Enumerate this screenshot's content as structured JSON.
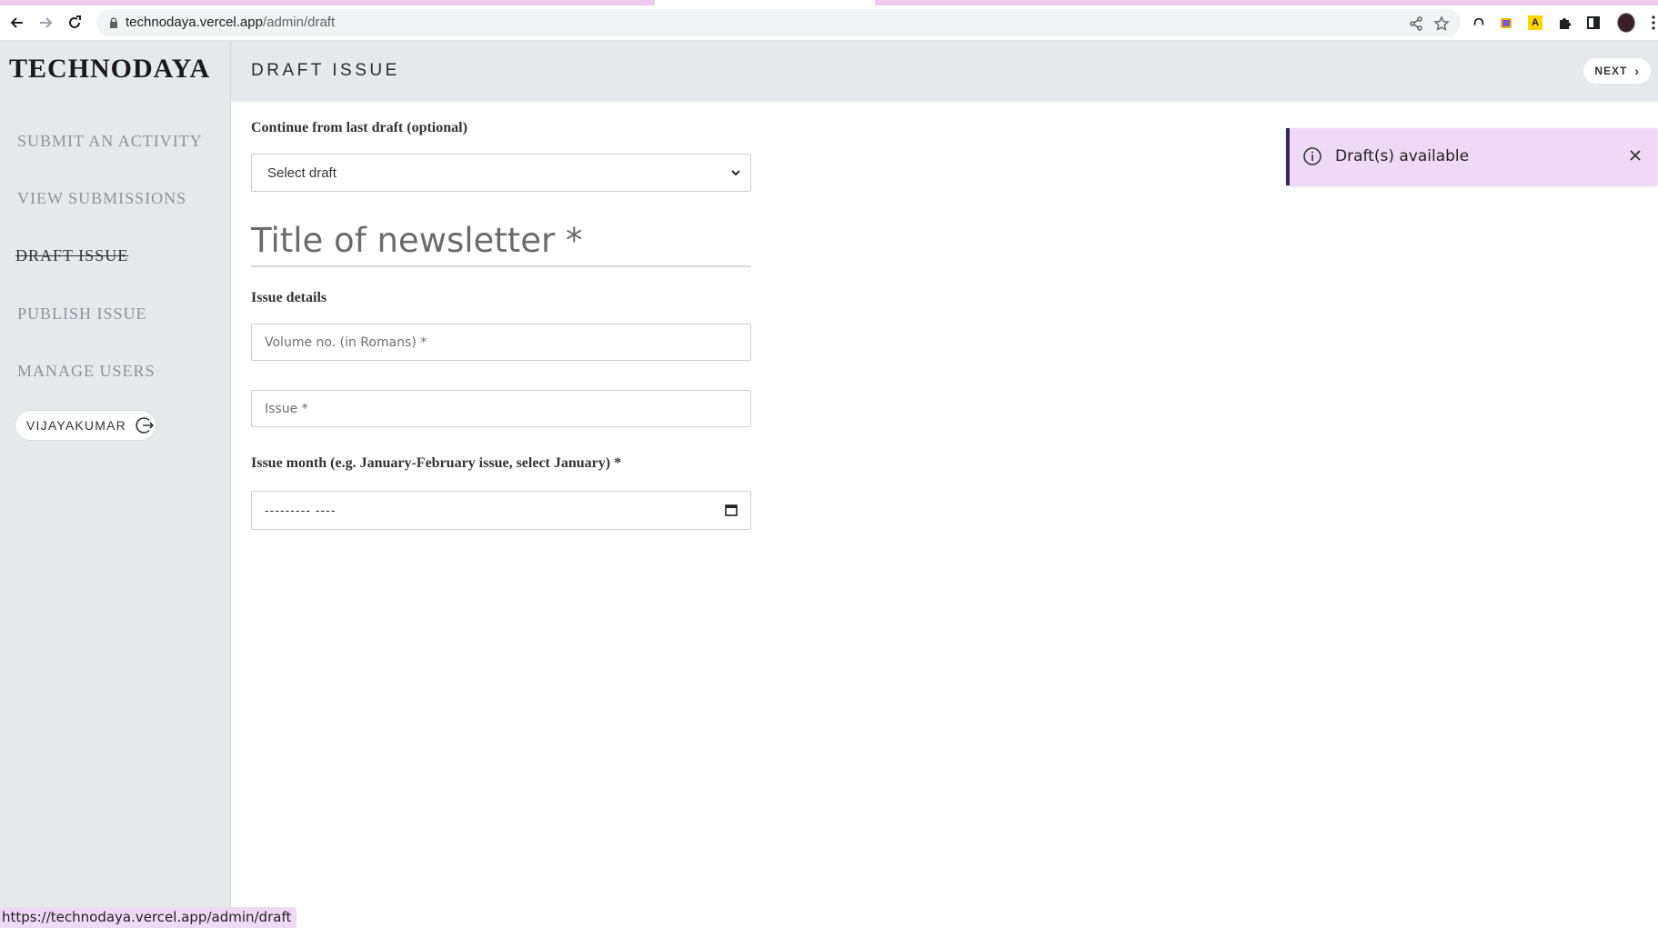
{
  "browser": {
    "url_host": "technodaya.vercel.app",
    "url_path": "/admin/draft",
    "status_url": "https://technodaya.vercel.app/admin/draft",
    "extension_badges": [
      "A"
    ]
  },
  "sidebar": {
    "logo": "TECHNODAYA",
    "items": [
      {
        "label": "SUBMIT AN ACTIVITY",
        "active": false
      },
      {
        "label": "VIEW SUBMISSIONS",
        "active": false
      },
      {
        "label": "DRAFT ISSUE",
        "active": true
      },
      {
        "label": "PUBLISH ISSUE",
        "active": false
      },
      {
        "label": "MANAGE USERS",
        "active": false
      }
    ],
    "user": {
      "name": "VIJAYAKUMAR"
    }
  },
  "header": {
    "title": "DRAFT ISSUE",
    "next_label": "NEXT"
  },
  "form": {
    "draft_label": "Continue from last draft (optional)",
    "draft_select_value": "Select draft",
    "title_placeholder": "Title of newsletter *",
    "issue_details_label": "Issue details",
    "volume_placeholder": "Volume no. (in Romans) *",
    "issue_placeholder": "Issue *",
    "month_label": "Issue month (e.g. January-February issue, select January) *",
    "month_value": "--------- ----"
  },
  "toast": {
    "message": "Draft(s) available"
  },
  "colors": {
    "sidebar_bg": "#e6e9ec",
    "toast_bg": "#f0d9f7",
    "toast_border": "#2d2a5a",
    "tab_accent": "#efc8ef"
  }
}
